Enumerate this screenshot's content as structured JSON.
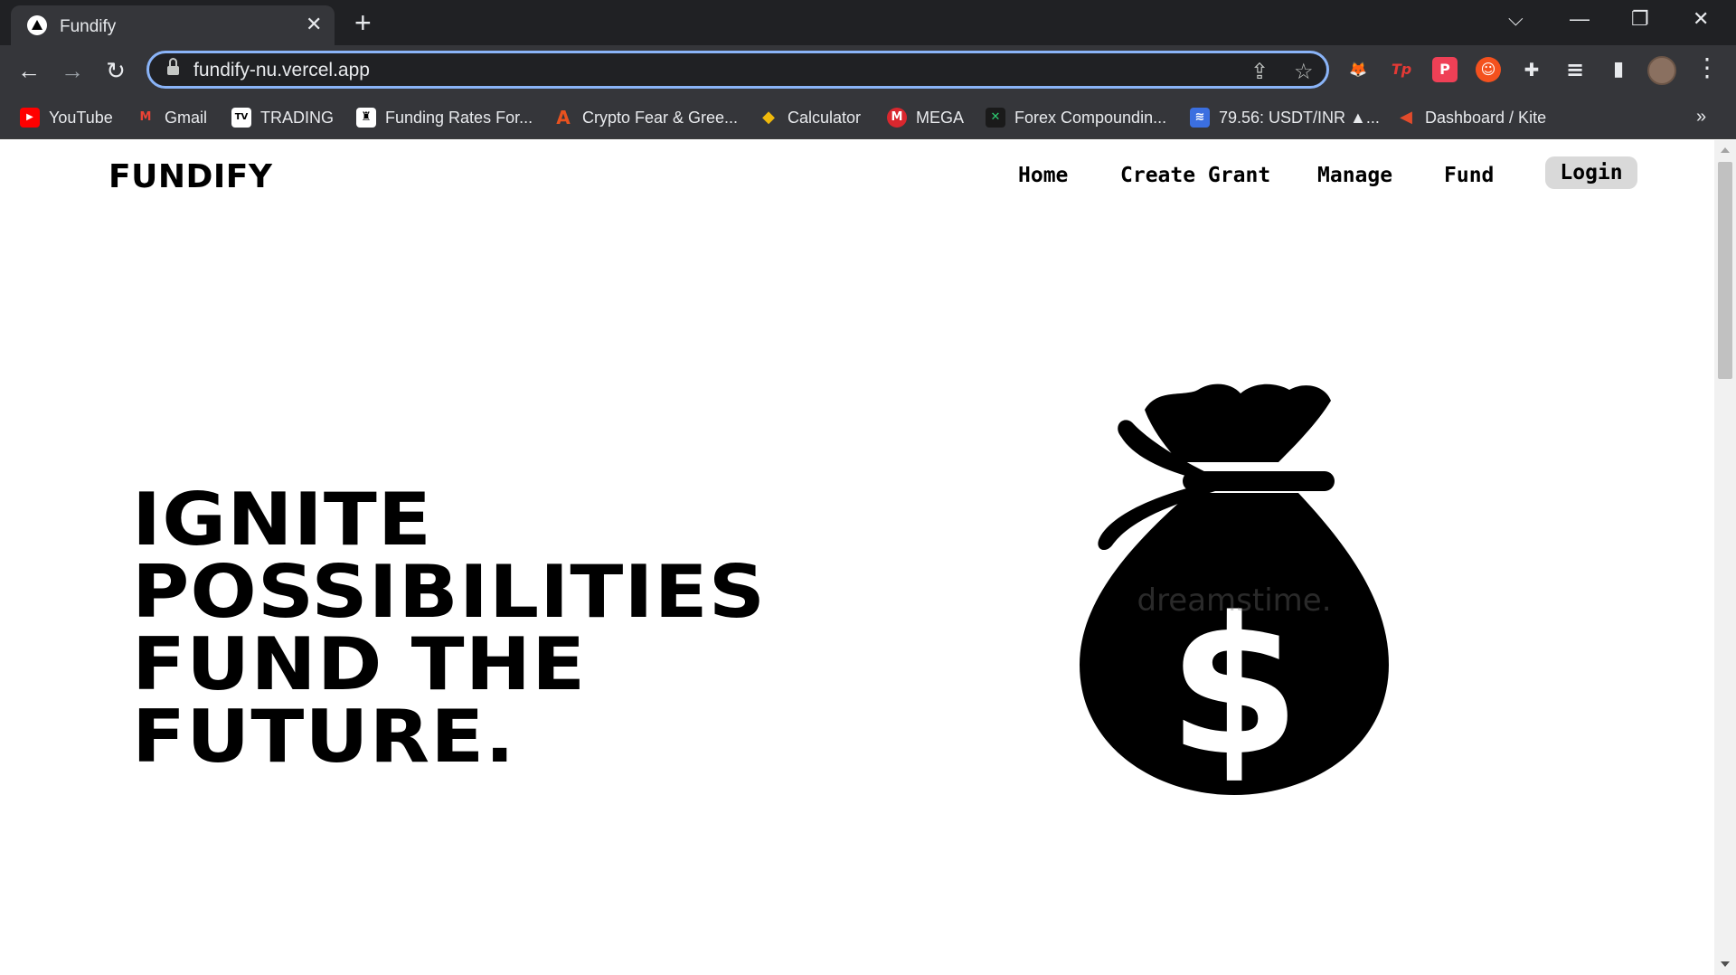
{
  "browser": {
    "tab": {
      "title": "Fundify",
      "close": "✕"
    },
    "new_tab": "+",
    "window_controls": {
      "tab_search": "⌵",
      "minimize": "—",
      "restore": "❐",
      "close": "✕"
    },
    "nav": {
      "back": "←",
      "forward": "→",
      "reload": "↻"
    },
    "address": {
      "url": "fundify-nu.vercel.app",
      "share": "⇪",
      "star": "☆"
    },
    "extensions": [
      {
        "name": "metamask-icon",
        "glyph": "🦊",
        "color": "#e8821e"
      },
      {
        "name": "tp-icon",
        "glyph": "Tp",
        "color": "#e53935"
      },
      {
        "name": "pocket-icon",
        "glyph": "P",
        "color": "#ef4056"
      },
      {
        "name": "emoji-icon",
        "glyph": "☺",
        "color": "#f4511e"
      },
      {
        "name": "puzzle-icon",
        "glyph": "✚",
        "color": "#5f6368"
      },
      {
        "name": "media-icon",
        "glyph": "≡",
        "color": "#5f6368"
      },
      {
        "name": "sidepanel-icon",
        "glyph": "▮",
        "color": "#5f6368"
      }
    ],
    "menu": "⋮",
    "bookmarks": [
      {
        "label": "YouTube",
        "icon": "youtube-icon",
        "glyph": "▶",
        "color": "#ff0000"
      },
      {
        "label": "Gmail",
        "icon": "gmail-icon",
        "glyph": "M",
        "color": "#ea4335"
      },
      {
        "label": "TRADING",
        "icon": "tradingview-icon",
        "glyph": "TV",
        "color": "#000000"
      },
      {
        "label": "Funding Rates For...",
        "icon": "funding-icon",
        "glyph": "♜",
        "color": "#000000"
      },
      {
        "label": "Crypto Fear & Gree...",
        "icon": "alternative-icon",
        "glyph": "A",
        "color": "#e8521f"
      },
      {
        "label": "Calculator",
        "icon": "binance-icon",
        "glyph": "◆",
        "color": "#f0b90b"
      },
      {
        "label": "MEGA",
        "icon": "mega-icon",
        "glyph": "M",
        "color": "#d9272e"
      },
      {
        "label": "Forex Compoundin...",
        "icon": "forex-icon",
        "glyph": "✕",
        "color": "#1a1a1a"
      },
      {
        "label": "79.56: USDT/INR ▲...",
        "icon": "chart-icon",
        "glyph": "≋",
        "color": "#3b6fe0"
      },
      {
        "label": "Dashboard / Kite",
        "icon": "kite-icon",
        "glyph": "◀",
        "color": "#e24b2b"
      }
    ],
    "bookmarks_more": "»"
  },
  "site": {
    "brand": "FUNDIFY",
    "nav": {
      "home": "Home",
      "create": "Create Grant",
      "manage": "Manage",
      "fund": "Fund",
      "login": "Login"
    },
    "hero_lines": [
      "IGNITE",
      "POSSIBILITIES",
      "FUND THE",
      "FUTURE."
    ],
    "watermark": "dreamstime."
  }
}
